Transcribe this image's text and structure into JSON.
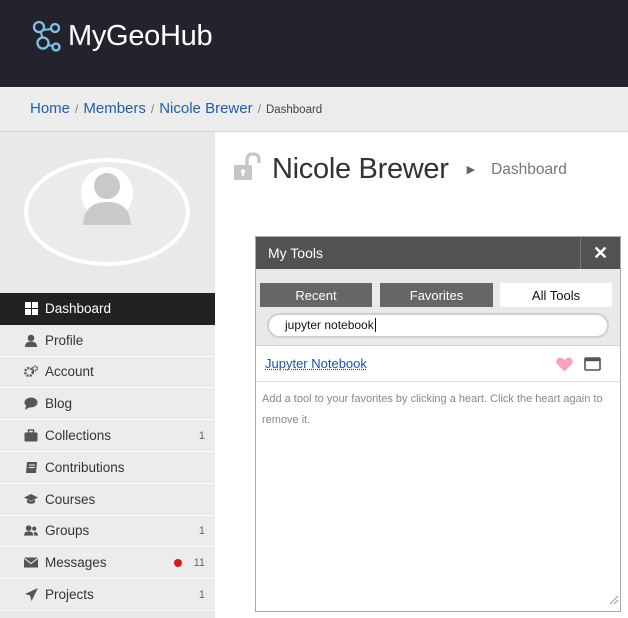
{
  "header": {
    "logo_text": "MyGeoHub"
  },
  "breadcrumb": {
    "home": "Home",
    "members": "Members",
    "member": "Nicole Brewer",
    "sep": "/",
    "current": "Dashboard"
  },
  "profile": {
    "name": "Nicole Brewer",
    "section": "Dashboard"
  },
  "sidebar": {
    "items": [
      {
        "label": "Dashboard",
        "icon": "grid-icon",
        "active": true
      },
      {
        "label": "Profile",
        "icon": "person-icon"
      },
      {
        "label": "Account",
        "icon": "gears-icon"
      },
      {
        "label": "Blog",
        "icon": "speech-bubble-icon"
      },
      {
        "label": "Collections",
        "icon": "briefcase-icon",
        "count": "1"
      },
      {
        "label": "Contributions",
        "icon": "book-icon"
      },
      {
        "label": "Courses",
        "icon": "mortarboard-icon"
      },
      {
        "label": "Groups",
        "icon": "people-icon",
        "count": "1"
      },
      {
        "label": "Messages",
        "icon": "envelope-icon",
        "count": "11",
        "unread_dot": true
      },
      {
        "label": "Projects",
        "icon": "paper-plane-icon",
        "count": "1"
      }
    ]
  },
  "tools_panel": {
    "title": "My Tools",
    "close": "✕",
    "tabs": {
      "recent": "Recent",
      "favorites": "Favorites",
      "all": "All Tools"
    },
    "search_value": "jupyter notebook",
    "results": [
      {
        "name": "Jupyter Notebook"
      }
    ],
    "hint": "Add a tool to your favorites by clicking a heart. Click the heart again to remove it."
  },
  "colors": {
    "header_bg": "#22232d",
    "link": "#1f4f9f",
    "active_nav": "#222222",
    "heart": "#f4a3bb",
    "unread_dot": "#cc1f1f"
  }
}
